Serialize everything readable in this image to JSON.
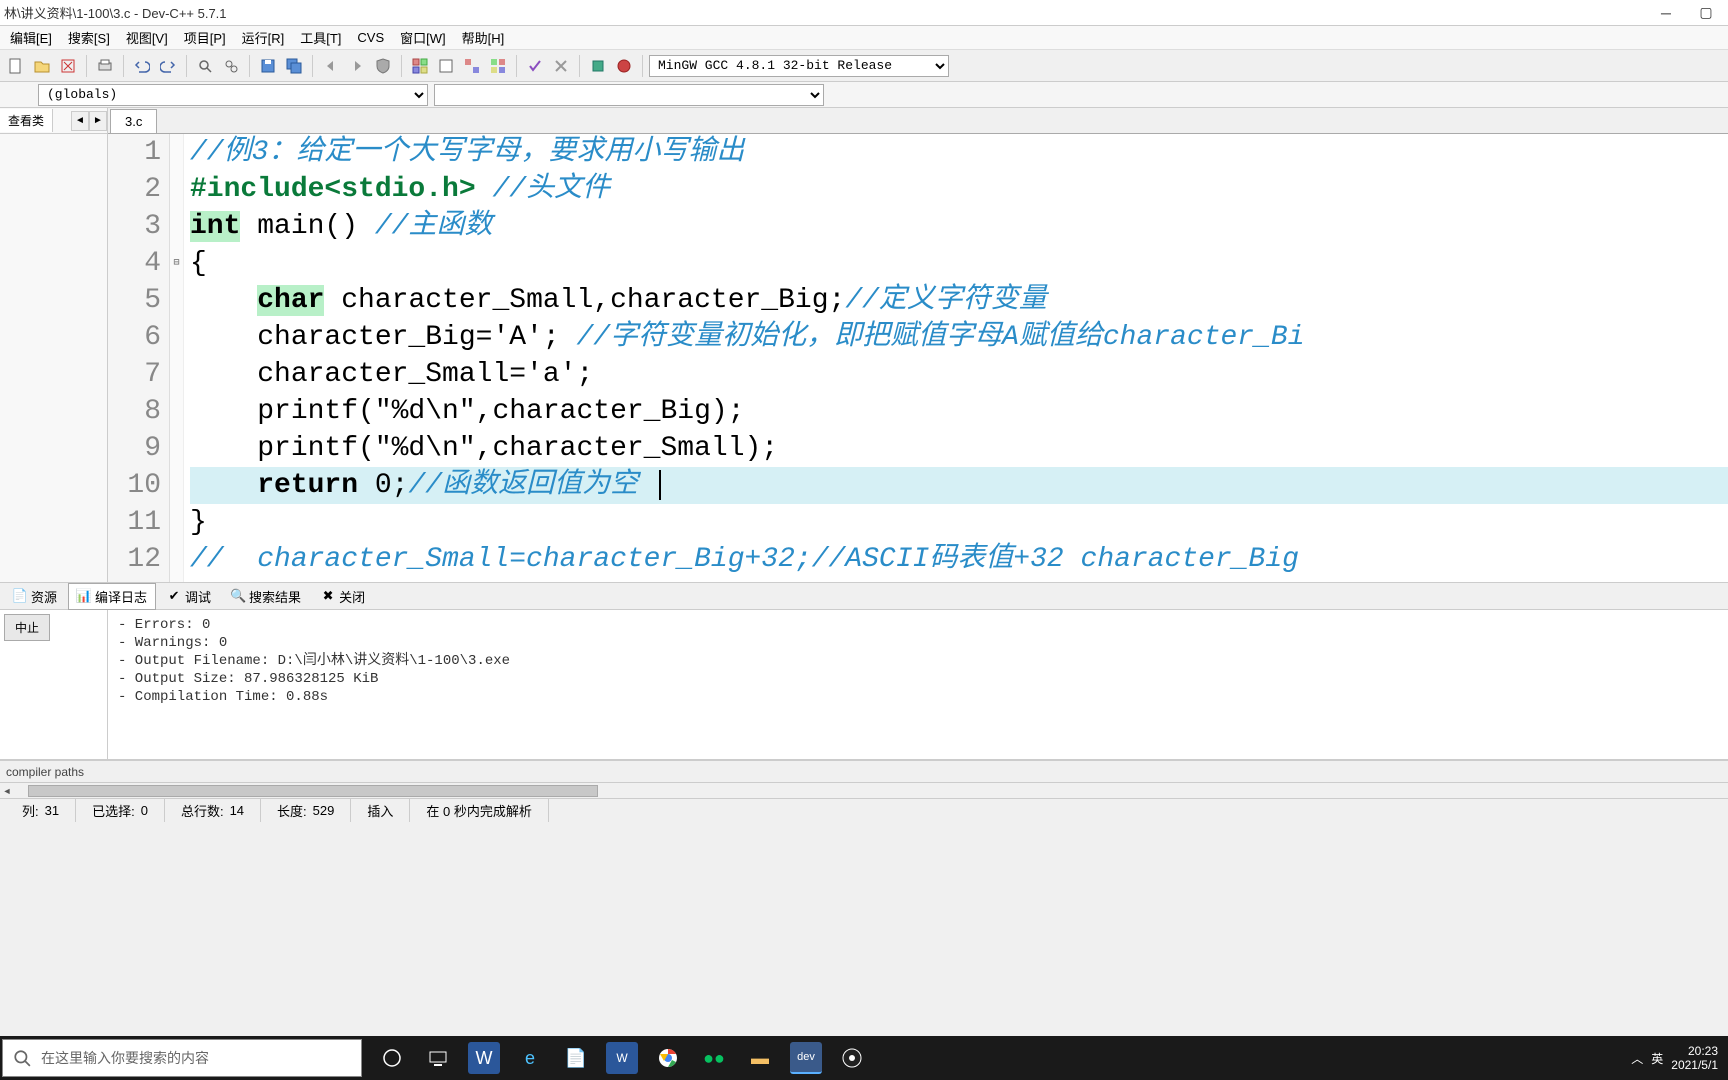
{
  "window": {
    "title": "林\\讲义资料\\1-100\\3.c - Dev-C++ 5.7.1"
  },
  "menu": {
    "items": [
      "编辑[E]",
      "搜索[S]",
      "视图[V]",
      "项目[P]",
      "运行[R]",
      "工具[T]",
      "CVS",
      "窗口[W]",
      "帮助[H]"
    ]
  },
  "compiler_select": "MinGW GCC 4.8.1 32-bit Release",
  "globals_select": "(globals)",
  "left_panel": {
    "tab": "查看类"
  },
  "file_tab": "3.c",
  "code": {
    "lines": [
      {
        "n": "1",
        "segs": [
          {
            "t": "//例3：给定一个大写字母，要求用小写输出",
            "c": "cmt"
          }
        ]
      },
      {
        "n": "2",
        "segs": [
          {
            "t": "#include<stdio.h>",
            "c": "pp"
          },
          {
            "t": " "
          },
          {
            "t": "//头文件",
            "c": "cmt"
          }
        ]
      },
      {
        "n": "3",
        "segs": [
          {
            "t": "int",
            "c": "kw"
          },
          {
            "t": " main() "
          },
          {
            "t": "//主函数",
            "c": "cmt"
          }
        ]
      },
      {
        "n": "4",
        "segs": [
          {
            "t": "{"
          }
        ],
        "fold": "⊟"
      },
      {
        "n": "5",
        "segs": [
          {
            "t": "    "
          },
          {
            "t": "char",
            "c": "kw"
          },
          {
            "t": " character_Small,character_Big;"
          },
          {
            "t": "//定义字符变量",
            "c": "cmt"
          }
        ]
      },
      {
        "n": "6",
        "segs": [
          {
            "t": "    character_Big='A'; "
          },
          {
            "t": "//字符变量初始化，即把赋值字母A赋值给character_Bi",
            "c": "cmt"
          }
        ]
      },
      {
        "n": "7",
        "segs": [
          {
            "t": "    character_Small='a';"
          }
        ]
      },
      {
        "n": "8",
        "segs": [
          {
            "t": "    printf(\"%d\\n\",character_Big);"
          }
        ]
      },
      {
        "n": "9",
        "segs": [
          {
            "t": "    printf(\"%d\\n\",character_Small);"
          }
        ]
      },
      {
        "n": "10",
        "segs": [
          {
            "t": "    "
          },
          {
            "t": "return",
            "c": "kw-plain"
          },
          {
            "t": " 0;"
          },
          {
            "t": "//函数返回值为空 ",
            "c": "cmt"
          }
        ],
        "hl": true,
        "cursor": true
      },
      {
        "n": "11",
        "segs": [
          {
            "t": "}"
          }
        ]
      },
      {
        "n": "12",
        "segs": [
          {
            "t": "//  character_Small=character_Big+32;//ASCII码表值+32 character_Big",
            "c": "cmt"
          }
        ]
      }
    ]
  },
  "bottom_tabs": {
    "items": [
      "资源",
      "编译日志",
      "调试",
      "搜索结果",
      "关闭"
    ],
    "active": 1
  },
  "output": {
    "stop": "中止",
    "lines": "- Errors: 0\n- Warnings: 0\n- Output Filename: D:\\闫小林\\讲义资料\\1-100\\3.exe\n- Output Size: 87.986328125 KiB\n- Compilation Time: 0.88s",
    "compiler_paths": "compiler paths"
  },
  "status": {
    "col_label": "列:",
    "col": "31",
    "sel_label": "已选择:",
    "sel": "0",
    "lines_label": "总行数:",
    "lines": "14",
    "len_label": "长度:",
    "len": "529",
    "mode": "插入",
    "parse": "在 0 秒内完成解析"
  },
  "taskbar": {
    "search_placeholder": "在这里输入你要搜索的内容",
    "ime": "英",
    "time": "20:23",
    "date": "2021/5/1"
  }
}
